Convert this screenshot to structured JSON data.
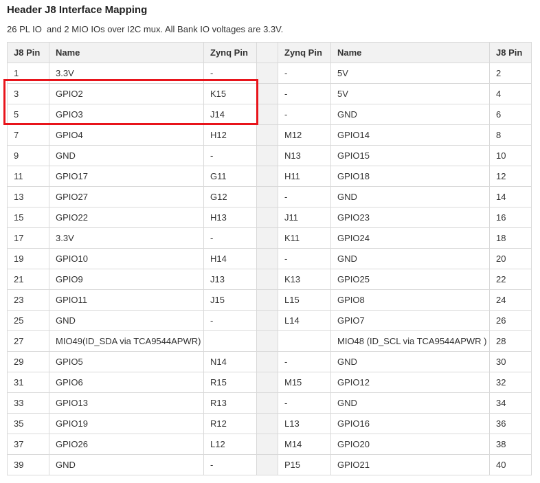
{
  "header": {
    "title": "Header J8 Interface Mapping",
    "subtitle": "26 PL IO  and 2 MIO IOs over I2C mux. All Bank IO voltages are 3.3V."
  },
  "table": {
    "columns": [
      "J8 Pin",
      "Name",
      "Zynq Pin",
      "",
      "Zynq Pin",
      "Name",
      "J8 Pin"
    ],
    "rows": [
      {
        "left_pin": "1",
        "left_name": "3.3V",
        "left_zynq": "-",
        "right_zynq": "-",
        "right_name": "5V",
        "right_pin": "2"
      },
      {
        "left_pin": "3",
        "left_name": "GPIO2",
        "left_zynq": "K15",
        "right_zynq": "-",
        "right_name": "5V",
        "right_pin": "4"
      },
      {
        "left_pin": "5",
        "left_name": "GPIO3",
        "left_zynq": "J14",
        "right_zynq": "-",
        "right_name": "GND",
        "right_pin": "6"
      },
      {
        "left_pin": "7",
        "left_name": "GPIO4",
        "left_zynq": "H12",
        "right_zynq": "M12",
        "right_name": "GPIO14",
        "right_pin": "8"
      },
      {
        "left_pin": "9",
        "left_name": "GND",
        "left_zynq": "-",
        "right_zynq": "N13",
        "right_name": "GPIO15",
        "right_pin": "10"
      },
      {
        "left_pin": "11",
        "left_name": "GPIO17",
        "left_zynq": "G11",
        "right_zynq": "H11",
        "right_name": "GPIO18",
        "right_pin": "12"
      },
      {
        "left_pin": "13",
        "left_name": "GPIO27",
        "left_zynq": "G12",
        "right_zynq": "-",
        "right_name": "GND",
        "right_pin": "14"
      },
      {
        "left_pin": "15",
        "left_name": "GPIO22",
        "left_zynq": "H13",
        "right_zynq": "J11",
        "right_name": "GPIO23",
        "right_pin": "16"
      },
      {
        "left_pin": "17",
        "left_name": "3.3V",
        "left_zynq": "-",
        "right_zynq": "K11",
        "right_name": "GPIO24",
        "right_pin": "18"
      },
      {
        "left_pin": "19",
        "left_name": "GPIO10",
        "left_zynq": "H14",
        "right_zynq": "-",
        "right_name": "GND",
        "right_pin": "20"
      },
      {
        "left_pin": "21",
        "left_name": "GPIO9",
        "left_zynq": "J13",
        "right_zynq": "K13",
        "right_name": "GPIO25",
        "right_pin": "22"
      },
      {
        "left_pin": "23",
        "left_name": "GPIO11",
        "left_zynq": "J15",
        "right_zynq": "L15",
        "right_name": "GPIO8",
        "right_pin": "24"
      },
      {
        "left_pin": "25",
        "left_name": "GND",
        "left_zynq": "-",
        "right_zynq": "L14",
        "right_name": "GPIO7",
        "right_pin": "26"
      },
      {
        "left_pin": "27",
        "left_name": "MIO49(ID_SDA via TCA9544APWR)",
        "left_zynq": "",
        "right_zynq": "",
        "right_name": "MIO48 (ID_SCL via TCA9544APWR )",
        "right_pin": "28"
      },
      {
        "left_pin": "29",
        "left_name": "GPIO5",
        "left_zynq": "N14",
        "right_zynq": "-",
        "right_name": "GND",
        "right_pin": "30"
      },
      {
        "left_pin": "31",
        "left_name": "GPIO6",
        "left_zynq": "R15",
        "right_zynq": "M15",
        "right_name": "GPIO12",
        "right_pin": "32"
      },
      {
        "left_pin": "33",
        "left_name": "GPIO13",
        "left_zynq": "R13",
        "right_zynq": "-",
        "right_name": "GND",
        "right_pin": "34"
      },
      {
        "left_pin": "35",
        "left_name": "GPIO19",
        "left_zynq": "R12",
        "right_zynq": "L13",
        "right_name": "GPIO16",
        "right_pin": "36"
      },
      {
        "left_pin": "37",
        "left_name": "GPIO26",
        "left_zynq": "L12",
        "right_zynq": "M14",
        "right_name": "GPIO20",
        "right_pin": "38"
      },
      {
        "left_pin": "39",
        "left_name": "GND",
        "left_zynq": "-",
        "right_zynq": "P15",
        "right_name": "GPIO21",
        "right_pin": "40"
      }
    ]
  },
  "annotation": {
    "highlight_color": "#e8141b"
  }
}
